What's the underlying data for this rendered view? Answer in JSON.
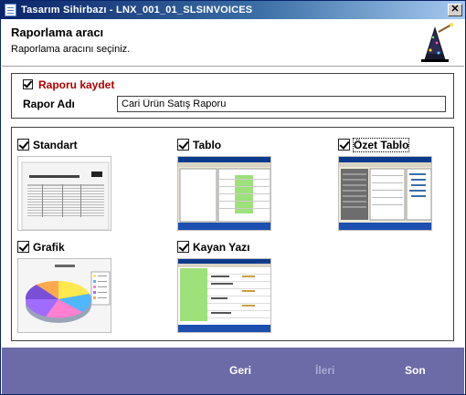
{
  "window": {
    "title": "Tasarım Sihirbazı - LNX_001_01_SLSINVOICES",
    "close_glyph": "✕"
  },
  "header": {
    "title": "Raporlama aracı",
    "subtitle": "Raporlama aracını seçiniz."
  },
  "save": {
    "checkbox_label": "Raporu kaydet",
    "checked": true,
    "name_label": "Rapor Adı",
    "name_value": "Cari Ürün Satış Raporu"
  },
  "tools": [
    {
      "label": "Standart",
      "checked": true
    },
    {
      "label": "Tablo",
      "checked": true
    },
    {
      "label": "Özet Tablo",
      "checked": true
    },
    {
      "label": "Grafik",
      "checked": true
    },
    {
      "label": "Kayan Yazı",
      "checked": true
    }
  ],
  "footer": {
    "back": "Geri",
    "next": "İleri",
    "finish": "Son"
  },
  "colors": {
    "title_gradient_start": "#0a246a",
    "footer_bg": "#6b6ba8",
    "save_label": "#b00000"
  },
  "icons": {
    "app": "document-icon",
    "wizard": "wizard-hat-icon",
    "close": "close-icon",
    "check": "check-icon"
  }
}
